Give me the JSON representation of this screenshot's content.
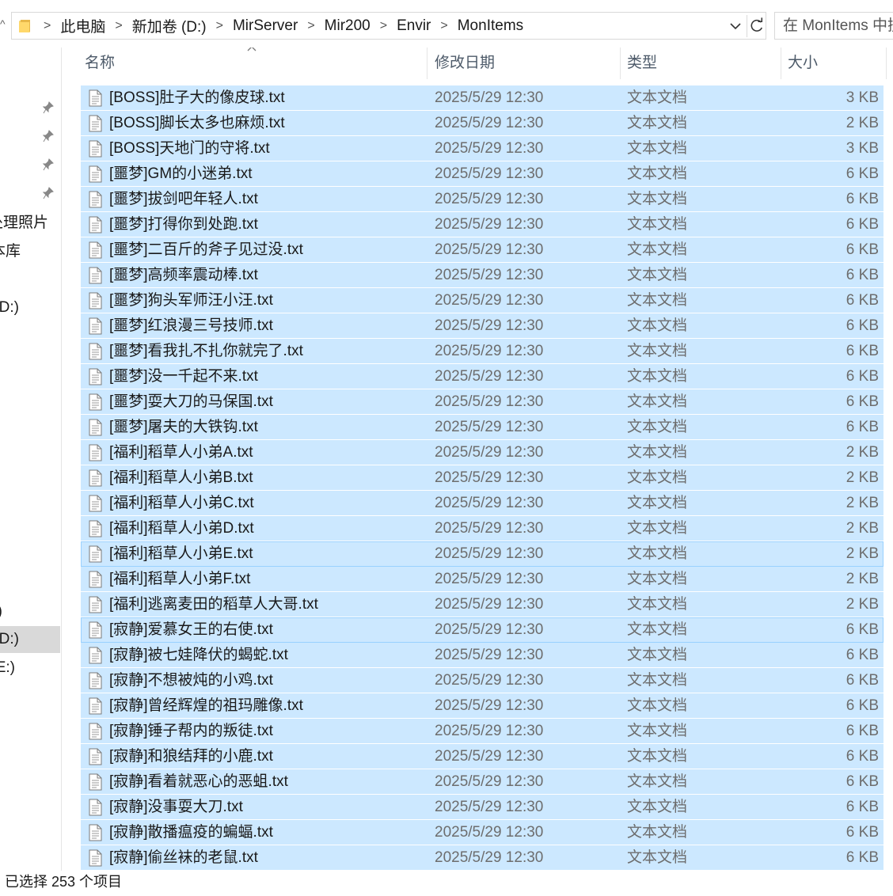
{
  "address_bar": {
    "crumbs": [
      "此电脑",
      "新加卷 (D:)",
      "MirServer",
      "Mir200",
      "Envir",
      "MonItems"
    ]
  },
  "search": {
    "placeholder": "在 MonItems 中搜索"
  },
  "nav": {
    "items": [
      {
        "label": "处理照片",
        "selected": false
      },
      {
        "label": "本库",
        "selected": false
      },
      {
        "label": "(D:)",
        "selected": false
      },
      {
        "label": ")",
        "selected": false
      },
      {
        "label": "(D:)",
        "selected": true
      },
      {
        "label": "(E:)",
        "selected": false
      }
    ]
  },
  "columns": {
    "name": "名称",
    "date": "修改日期",
    "type": "类型",
    "size": "大小"
  },
  "files": [
    {
      "name": "[BOSS]肚子大的像皮球.txt",
      "date": "2025/5/29 12:30",
      "type": "文本文档",
      "size": "3 KB"
    },
    {
      "name": "[BOSS]脚长太多也麻烦.txt",
      "date": "2025/5/29 12:30",
      "type": "文本文档",
      "size": "2 KB"
    },
    {
      "name": "[BOSS]天地门的守将.txt",
      "date": "2025/5/29 12:30",
      "type": "文本文档",
      "size": "3 KB"
    },
    {
      "name": "[噩梦]GM的小迷弟.txt",
      "date": "2025/5/29 12:30",
      "type": "文本文档",
      "size": "6 KB"
    },
    {
      "name": "[噩梦]拔剑吧年轻人.txt",
      "date": "2025/5/29 12:30",
      "type": "文本文档",
      "size": "6 KB"
    },
    {
      "name": "[噩梦]打得你到处跑.txt",
      "date": "2025/5/29 12:30",
      "type": "文本文档",
      "size": "6 KB"
    },
    {
      "name": "[噩梦]二百斤的斧子见过没.txt",
      "date": "2025/5/29 12:30",
      "type": "文本文档",
      "size": "6 KB"
    },
    {
      "name": "[噩梦]高频率震动棒.txt",
      "date": "2025/5/29 12:30",
      "type": "文本文档",
      "size": "6 KB"
    },
    {
      "name": "[噩梦]狗头军师汪小汪.txt",
      "date": "2025/5/29 12:30",
      "type": "文本文档",
      "size": "6 KB"
    },
    {
      "name": "[噩梦]红浪漫三号技师.txt",
      "date": "2025/5/29 12:30",
      "type": "文本文档",
      "size": "6 KB"
    },
    {
      "name": "[噩梦]看我扎不扎你就完了.txt",
      "date": "2025/5/29 12:30",
      "type": "文本文档",
      "size": "6 KB"
    },
    {
      "name": "[噩梦]没一千起不来.txt",
      "date": "2025/5/29 12:30",
      "type": "文本文档",
      "size": "6 KB"
    },
    {
      "name": "[噩梦]耍大刀的马保国.txt",
      "date": "2025/5/29 12:30",
      "type": "文本文档",
      "size": "6 KB"
    },
    {
      "name": "[噩梦]屠夫的大铁钩.txt",
      "date": "2025/5/29 12:30",
      "type": "文本文档",
      "size": "6 KB"
    },
    {
      "name": "[福利]稻草人小弟A.txt",
      "date": "2025/5/29 12:30",
      "type": "文本文档",
      "size": "2 KB"
    },
    {
      "name": "[福利]稻草人小弟B.txt",
      "date": "2025/5/29 12:30",
      "type": "文本文档",
      "size": "2 KB"
    },
    {
      "name": "[福利]稻草人小弟C.txt",
      "date": "2025/5/29 12:30",
      "type": "文本文档",
      "size": "2 KB"
    },
    {
      "name": "[福利]稻草人小弟D.txt",
      "date": "2025/5/29 12:30",
      "type": "文本文档",
      "size": "2 KB"
    },
    {
      "name": "[福利]稻草人小弟E.txt",
      "date": "2025/5/29 12:30",
      "type": "文本文档",
      "size": "2 KB"
    },
    {
      "name": "[福利]稻草人小弟F.txt",
      "date": "2025/5/29 12:30",
      "type": "文本文档",
      "size": "2 KB"
    },
    {
      "name": "[福利]逃离麦田的稻草人大哥.txt",
      "date": "2025/5/29 12:30",
      "type": "文本文档",
      "size": "2 KB"
    },
    {
      "name": "[寂静]爱慕女王的右使.txt",
      "date": "2025/5/29 12:30",
      "type": "文本文档",
      "size": "6 KB"
    },
    {
      "name": "[寂静]被七娃降伏的蝎蛇.txt",
      "date": "2025/5/29 12:30",
      "type": "文本文档",
      "size": "6 KB"
    },
    {
      "name": "[寂静]不想被炖的小鸡.txt",
      "date": "2025/5/29 12:30",
      "type": "文本文档",
      "size": "6 KB"
    },
    {
      "name": "[寂静]曾经辉煌的祖玛雕像.txt",
      "date": "2025/5/29 12:30",
      "type": "文本文档",
      "size": "6 KB"
    },
    {
      "name": "[寂静]锤子帮内的叛徒.txt",
      "date": "2025/5/29 12:30",
      "type": "文本文档",
      "size": "6 KB"
    },
    {
      "name": "[寂静]和狼结拜的小鹿.txt",
      "date": "2025/5/29 12:30",
      "type": "文本文档",
      "size": "6 KB"
    },
    {
      "name": "[寂静]看着就恶心的恶蛆.txt",
      "date": "2025/5/29 12:30",
      "type": "文本文档",
      "size": "6 KB"
    },
    {
      "name": "[寂静]没事耍大刀.txt",
      "date": "2025/5/29 12:30",
      "type": "文本文档",
      "size": "6 KB"
    },
    {
      "name": "[寂静]散播瘟疫的蝙蝠.txt",
      "date": "2025/5/29 12:30",
      "type": "文本文档",
      "size": "6 KB"
    },
    {
      "name": "[寂静]偷丝袜的老鼠.txt",
      "date": "2025/5/29 12:30",
      "type": "文本文档",
      "size": "6 KB"
    }
  ],
  "status": {
    "text": "已选择 253 个项目"
  },
  "colors": {
    "selection": "#cce8ff",
    "selection_border": "#99d1ff",
    "header_text": "#4d5a69"
  }
}
